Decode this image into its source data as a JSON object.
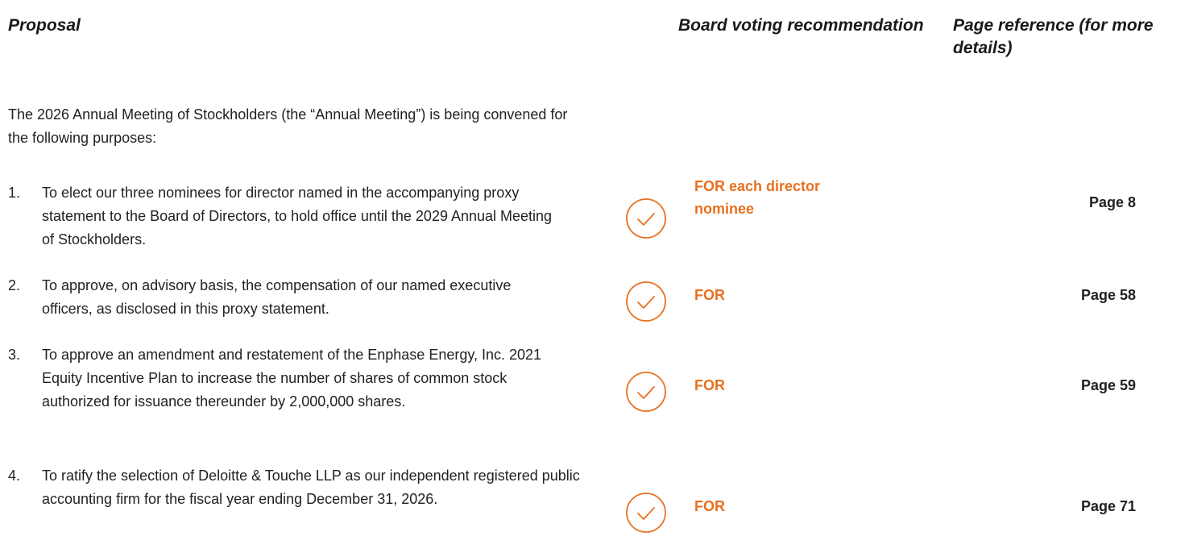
{
  "headers": {
    "proposal": "Proposal",
    "board": "Board voting recommendation",
    "page": "Page reference (for more details)"
  },
  "intro": "The 2026 Annual Meeting of Stockholders (the “Annual Meeting”) is being convened for the following purposes:",
  "items": [
    {
      "num": "1.",
      "text": "To elect our three nominees for director named in the accompanying proxy statement to the Board of Directors, to hold office until the 2029 Annual Meeting of Stockholders.",
      "recommendation": "FOR each director nominee",
      "page": "Page 8"
    },
    {
      "num": "2.",
      "text": "To approve, on advisory basis, the compensation of our named executive officers, as disclosed in this proxy statement.",
      "recommendation": "FOR",
      "page": "Page 58"
    },
    {
      "num": "3.",
      "text": "To approve an amendment and restatement of the Enphase Energy, Inc. 2021 Equity Incentive Plan to increase the number of shares of common stock authorized for issuance thereunder by 2,000,000 shares.",
      "recommendation": "FOR",
      "page": "Page 59"
    },
    {
      "num": "4.",
      "text": "To ratify the selection of Deloitte & Touche LLP as our independent registered public accounting firm for the fiscal year ending December 31, 2026.",
      "recommendation": "FOR",
      "page": "Page 71"
    }
  ],
  "icons": {
    "check": "check-circle-icon"
  },
  "colors": {
    "accent": "#e8701f",
    "text": "#222222"
  }
}
